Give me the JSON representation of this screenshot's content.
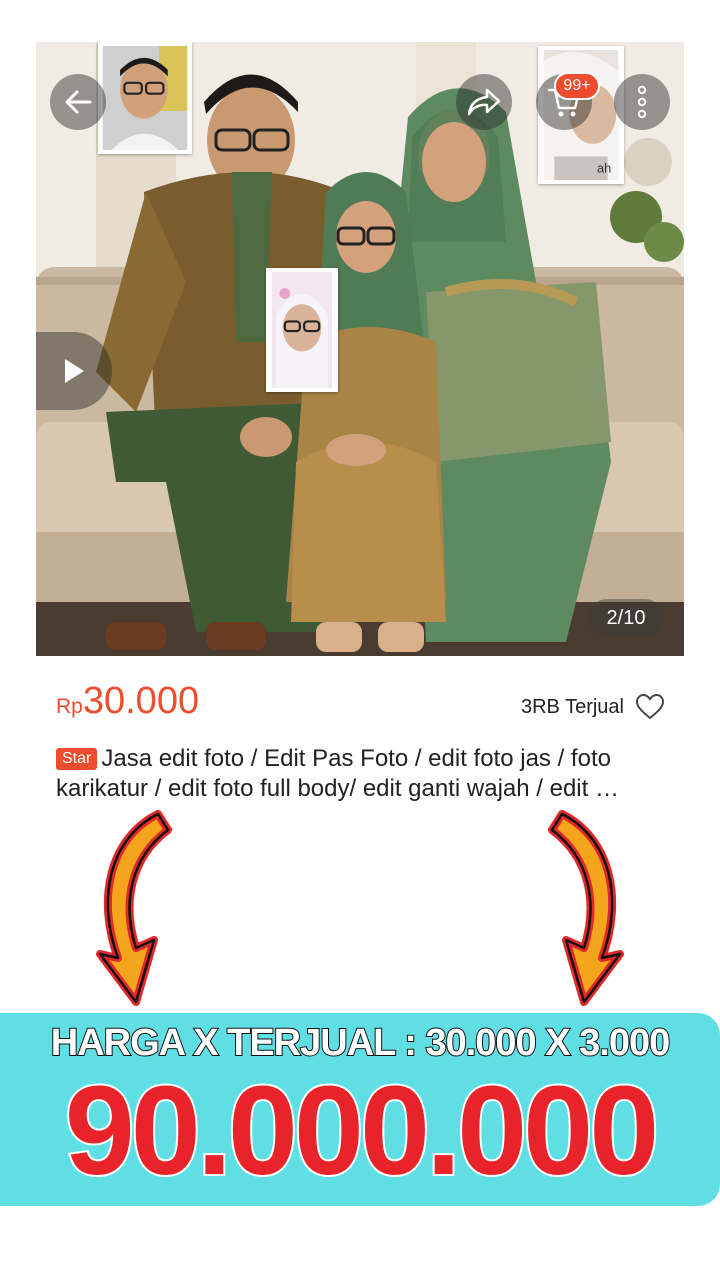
{
  "gallery": {
    "counter": "2/10",
    "cart_badge": "99+",
    "icons": [
      "back-arrow-icon",
      "share-icon",
      "cart-icon",
      "more-vertical-icon",
      "play-icon"
    ]
  },
  "product": {
    "currency": "Rp",
    "price": "30.000",
    "sold": "3RB Terjual",
    "tag": "Star",
    "title": "Jasa edit foto / Edit Pas Foto / edit foto jas / foto karikatur / edit foto full body/ edit ganti wajah / edit …"
  },
  "banner": {
    "formula": "HARGA X TERJUAL : 30.000 X 3.000",
    "total": "90.000.000"
  },
  "colors": {
    "accent": "#ee4d2d",
    "banner_bg": "#5fdfe4",
    "total_text": "#e8232a",
    "arrow_fill": "#f5a51c",
    "arrow_outline": "#e3262a"
  }
}
